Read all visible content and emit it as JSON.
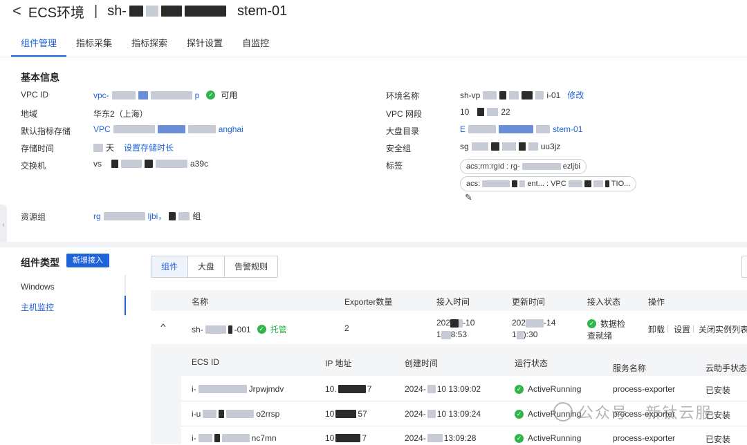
{
  "header": {
    "back": "<",
    "title": "ECS环境",
    "env_prefix": "sh-",
    "env_suffix": "stem-01"
  },
  "tabs": [
    "组件管理",
    "指标采集",
    "指标探索",
    "探针设置",
    "自监控"
  ],
  "basic": {
    "section_title": "基本信息",
    "left": {
      "vpc_id_label": "VPC ID",
      "vpc_id_value": "vpc-",
      "vpc_id_tail": "p",
      "vpc_status": "可用",
      "region_label": "地域",
      "region_value": "华东2（上海）",
      "storage_label": "默认指标存储",
      "storage_prefix": "VPC",
      "storage_tail": "anghai",
      "retention_label": "存储时间",
      "retention_value": "天",
      "retention_link": "设置存储时长",
      "switch_label": "交换机",
      "switch_prefix": "vs",
      "switch_tail": "a39c",
      "rg_label": "资源组",
      "rg_prefix": "rg",
      "rg_mid": "ljbi，",
      "rg_tail": "组"
    },
    "right": {
      "env_name_label": "环境名称",
      "env_name_prefix": "sh-vp",
      "env_name_tail": "i-01",
      "edit_link": "修改",
      "vpc_cidr_label": "VPC 网段",
      "vpc_cidr_prefix": "10",
      "vpc_cidr_tail": "22",
      "dashboard_label": "大盘目录",
      "dashboard_prefix": "E",
      "dashboard_tail": "stem-01",
      "sg_label": "安全组",
      "sg_prefix": "sg",
      "sg_tail": "uu3jz",
      "tags_label": "标签",
      "tag1_a": "acs:rm:rgId : rg-",
      "tag1_b": "ezljbi",
      "tag2_a": "acs:",
      "tag2_b": "ent... : VPC",
      "tag2_c": "TIO..."
    }
  },
  "components": {
    "type_title": "组件类型",
    "add_button": "新增接入",
    "types": [
      "Windows",
      "主机监控"
    ],
    "segments": [
      "组件",
      "大盘",
      "告警规则"
    ],
    "table_headers": [
      "名称",
      "Exporter数量",
      "接入时间",
      "更新时间",
      "接入状态",
      "操作"
    ],
    "row": {
      "expand": "^",
      "name_prefix": "sh-",
      "name_tail": "-001",
      "managed": "托管",
      "exporter_count": "2",
      "access_time_1": "202",
      "access_time_1b": "-10",
      "access_time_2": "1",
      "access_time_2b": "8:53",
      "update_time_1": "202",
      "update_time_1b": "-14",
      "update_time_2": "1",
      "update_time_2b": "):30",
      "status_1": "数据检",
      "status_2": "查就绪",
      "actions": [
        "卸载",
        "设置",
        "关闭实例列表"
      ]
    },
    "sub_headers": [
      "ECS ID",
      "IP 地址",
      "创建时间",
      "运行状态",
      "服务名称",
      "云助手状态"
    ],
    "sub_rows": [
      {
        "id_a": "i-",
        "id_b": "Jrpwjmdv",
        "ip_a": "10.",
        "ip_b": "7",
        "time_a": "2024-",
        "time_b": "10 13:09:02",
        "state": "ActiveRunning",
        "service": "process-exporter",
        "assistant": "已安装"
      },
      {
        "id_a": "i-u",
        "id_b": "o2rrsp",
        "ip_a": "10",
        "ip_b": "57",
        "time_a": "2024-",
        "time_b": "10 13:09:24",
        "state": "ActiveRunning",
        "service": "process-exporter",
        "assistant": "已安装"
      },
      {
        "id_a": "i-",
        "id_b": "nc7mn",
        "ip_a": "10",
        "ip_b": "7",
        "time_a": "2024-",
        "time_b": "13:09:28",
        "state": "ActiveRunning",
        "service": "process-exporter",
        "assistant": "已安装"
      }
    ]
  },
  "watermark": "公众号 · 新钛云服",
  "colors": {
    "accent": "#1f63d8",
    "ok": "#2fb54a"
  }
}
